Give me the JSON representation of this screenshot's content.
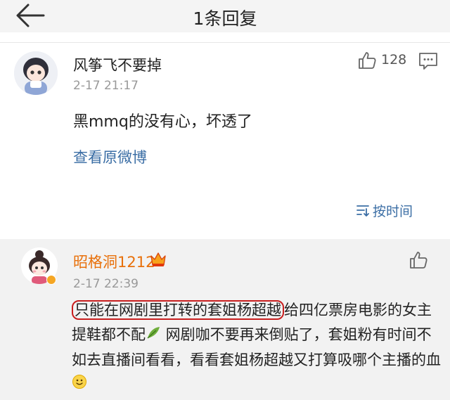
{
  "header": {
    "title": "1条回复"
  },
  "comment": {
    "username": "风筝飞不要掉",
    "timestamp": "2-17 21:17",
    "like_count": "128",
    "text": "黑mmq的没有心，坏透了",
    "view_original": "查看原微博"
  },
  "sort": {
    "label": "按时间"
  },
  "reply": {
    "username": "昭格洞1212",
    "timestamp": "2-17 22:39",
    "text_highlight": "只能在网剧里打转的套姐杨超越",
    "text_part1": "给四亿票房电影的女主提鞋都不配",
    "text_part2": " 网剧咖不要再来倒贴了，套姐粉有时间不如去直播间看看，看看套姐杨超越又打算吸哪个主播的血"
  },
  "colors": {
    "link_blue": "#3b6ea5",
    "username_orange": "#e8700a",
    "highlight_red": "#c81e1e",
    "reply_bg": "#f2f2f2"
  },
  "icons": [
    "back-arrow-icon",
    "thumbs-up-icon",
    "comment-icon",
    "sort-icon",
    "vip-crown-icon",
    "verified-icon",
    "leaf-emoji-icon",
    "smile-emoji-icon"
  ]
}
